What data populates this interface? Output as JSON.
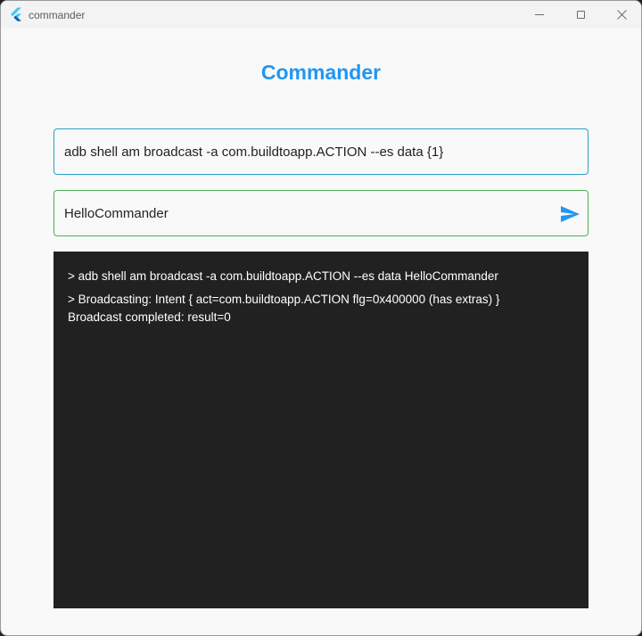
{
  "window": {
    "title": "commander",
    "app_icon": "flutter-logo-icon",
    "controls": [
      "minimize-icon",
      "maximize-icon",
      "close-icon"
    ]
  },
  "main": {
    "heading": "Commander"
  },
  "template_field": {
    "value": "adb shell am broadcast -a com.buildtoapp.ACTION --es data {1}"
  },
  "message_field": {
    "value": "HelloCommander",
    "send_icon": "send-icon"
  },
  "console": {
    "entries": [
      "> adb shell am broadcast -a com.buildtoapp.ACTION --es data HelloCommander",
      "> Broadcasting: Intent { act=com.buildtoapp.ACTION flg=0x400000 (has extras) }\nBroadcast completed: result=0"
    ]
  },
  "colors": {
    "accent": "#2196f3",
    "template_border": "#2aa0c4",
    "message_border": "#4caf50",
    "console_bg": "#212121"
  }
}
